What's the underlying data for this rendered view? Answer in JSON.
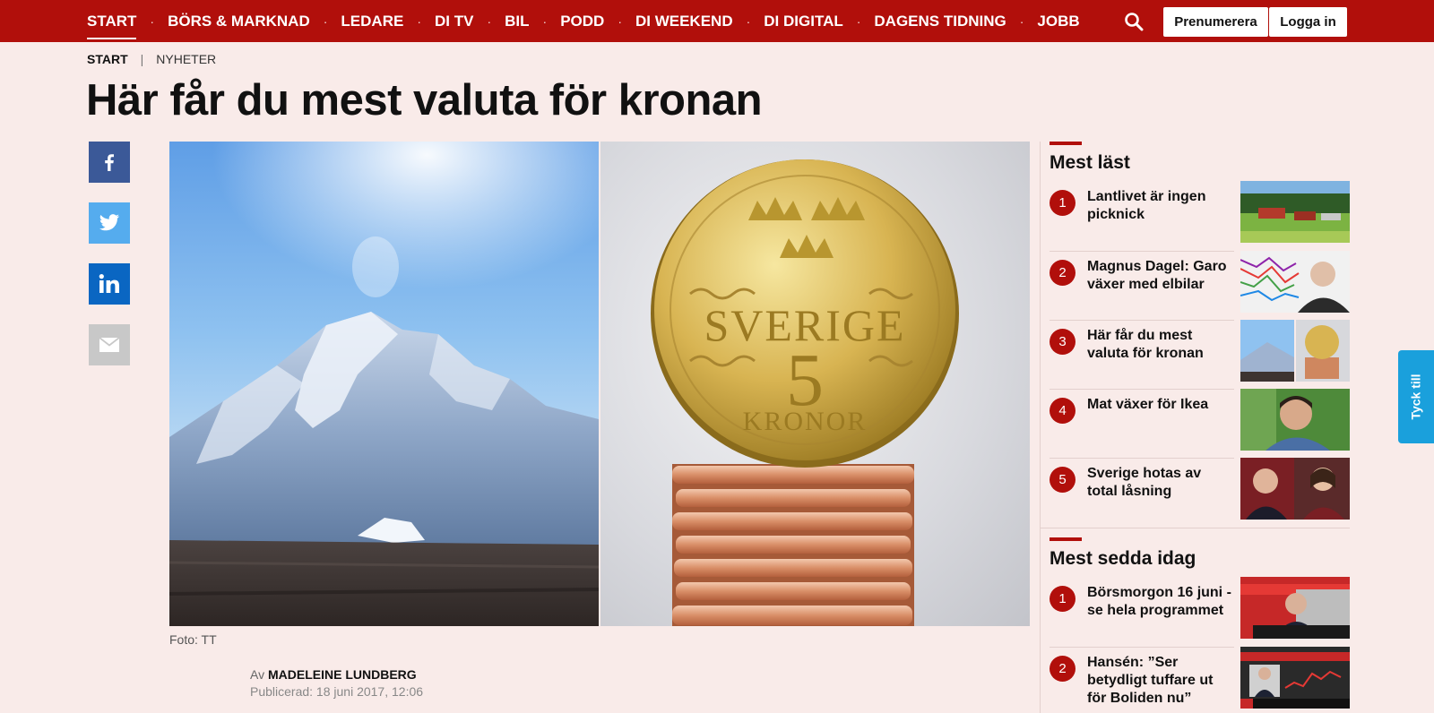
{
  "nav": {
    "items": [
      "START",
      "BÖRS & MARKNAD",
      "LEDARE",
      "DI TV",
      "BIL",
      "PODD",
      "DI WEEKEND",
      "DI DIGITAL",
      "DAGENS TIDNING",
      "JOBB"
    ],
    "separator": "·",
    "subscribe_label": "Prenumerera",
    "login_label": "Logga in",
    "search_icon": "search-icon"
  },
  "breadcrumb": {
    "start": "START",
    "separator": "|",
    "section": "NYHETER"
  },
  "article": {
    "title": "Här får du mest valuta för kronan",
    "photo_credit": "Foto: TT",
    "byline_prefix": "Av",
    "author": "MADELEINE LUNDBERG",
    "published": "Publicerad: 18 juni 2017, 12:06",
    "coin_text": {
      "country": "SVERIGE",
      "value": "5",
      "unit": "KRONOR"
    }
  },
  "share": {
    "facebook_icon": "facebook-icon",
    "twitter_icon": "twitter-icon",
    "linkedin_icon": "linkedin-icon",
    "email_icon": "email-icon"
  },
  "most_read": {
    "title": "Mest läst",
    "items": [
      {
        "num": "1",
        "text": "Lantlivet är ingen picknick"
      },
      {
        "num": "2",
        "text": "Magnus Dagel: Garo växer med elbilar"
      },
      {
        "num": "3",
        "text": "Här får du mest valuta för kronan"
      },
      {
        "num": "4",
        "text": "Mat växer för Ikea"
      },
      {
        "num": "5",
        "text": "Sverige hotas av total låsning"
      }
    ]
  },
  "most_viewed": {
    "title": "Mest sedda idag",
    "items": [
      {
        "num": "1",
        "text": "Börsmorgon 16 juni - se hela programmet"
      },
      {
        "num": "2",
        "text": "Hansén: ”Ser betydligt tuffare ut för Boliden nu”"
      }
    ]
  },
  "feedback_label": "Tyck till",
  "colors": {
    "brand_red": "#b10f0b",
    "page_bg": "#f9ebe9",
    "feedback_blue": "#1aa0dc"
  }
}
